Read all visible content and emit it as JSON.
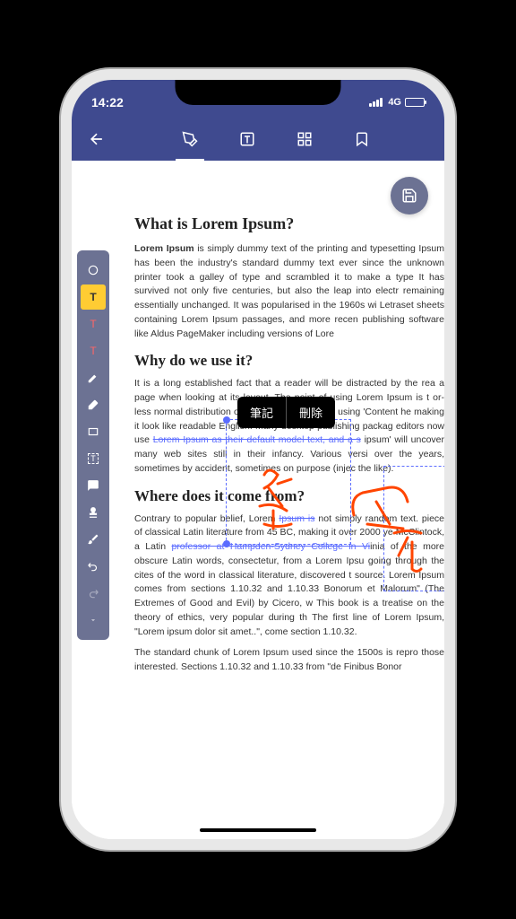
{
  "status": {
    "time": "14:22",
    "network": "4G"
  },
  "popup": {
    "note": "筆記",
    "delete": "刪除"
  },
  "doc": {
    "h1": "What is Lorem Ipsum?",
    "p1_strong": "Lorem Ipsum",
    "p1": " is simply dummy text of the printing and typesetting Ipsum has been the industry's standard dummy text ever since the unknown printer took a galley of type and scrambled it to make a type It has survived not only five centuries, but also the leap into electr remaining essentially unchanged. It was popularised in the 1960s wi Letraset sheets containing Lorem Ipsum passages, and more recen publishing software like Aldus PageMaker including versions of Lore",
    "h2a": "Why do we use it?",
    "p2a": "It is a long established fact that a reader will be distracted by the rea a page when looking at its layout. The point of using Lorem Ipsum is t or-less normal distribution of letters, as opposed to using 'Content he making it look like readable English. Many desktop publishing packag editors now use ",
    "p2_strike": "Lorem Ipsum as their default model text, and a s",
    "p2b": " ipsum' will uncover many web sites still in their infancy. Various versi over the years, sometimes by accident, sometimes on purpose (injec the like).",
    "h2b": "Where does it come from?",
    "p3a": "Contrary to popular belief, Lorem ",
    "p3_strike1": "Ipsum is",
    "p3b": " not simply random text. piece of classical Latin literature from 45 BC, making it over 2000 ye McClintock, a Latin ",
    "p3_strike2": "professor at Hampden-Sydney College in Vi",
    "p3c": "inia of the more obscure Latin words, consectetur, from a Lorem Ipsu going through the cites of the word in classical literature, discovered t source. Lorem Ipsum comes from sections 1.10.32 and 1.10.33 Bonorum et Malorum\" (The Extremes of Good and Evil) by Cicero, w This book is a treatise on the theory of ethics, very popular during th The first line of Lorem Ipsum, \"Lorem ipsum dolor sit amet..\", come section 1.10.32.",
    "p4": "The standard chunk of Lorem Ipsum used since the 1500s is repro those interested. Sections 1.10.32 and 1.10.33 from \"de Finibus Bonor"
  },
  "tools": {
    "highlight_label": "T",
    "text_tool_label": "T",
    "text_tool2_label": "T",
    "textbox_label": "T"
  }
}
